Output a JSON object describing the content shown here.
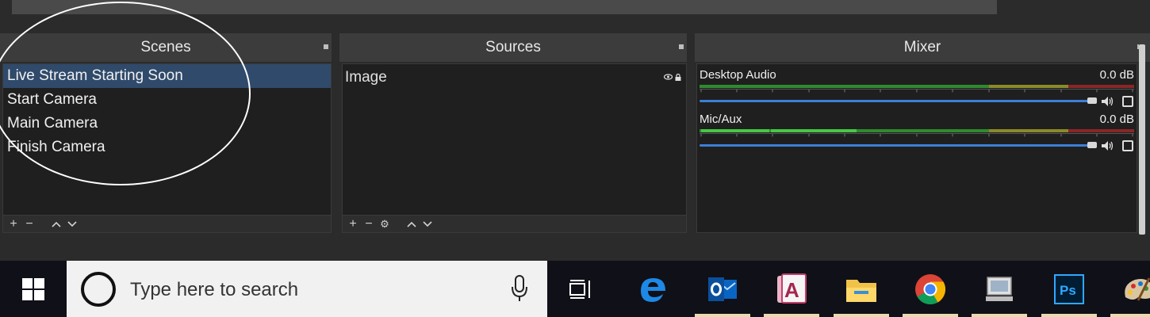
{
  "docks": {
    "scenes": {
      "title": "Scenes"
    },
    "sources": {
      "title": "Sources"
    },
    "mixer": {
      "title": "Mixer"
    }
  },
  "scenes": {
    "items": [
      {
        "label": "Live Stream Starting Soon",
        "selected": true
      },
      {
        "label": "Start Camera"
      },
      {
        "label": "Main Camera"
      },
      {
        "label": "Finish Camera"
      }
    ],
    "footer": {
      "add": "+",
      "remove": "−",
      "up": "⌃",
      "down": "⌄"
    }
  },
  "sources": {
    "items": [
      {
        "label": "Image",
        "visible": true,
        "locked": false
      }
    ],
    "footer": {
      "add": "+",
      "remove": "−",
      "settings": "⚙",
      "up": "⌃",
      "down": "⌄"
    }
  },
  "mixer": {
    "channels": [
      {
        "name": "Desktop Audio",
        "level": "0.0 dB",
        "volume": 1.0
      },
      {
        "name": "Mic/Aux",
        "level": "0.0 dB",
        "volume": 1.0
      }
    ]
  },
  "taskbar": {
    "search_placeholder": "Type here to search",
    "icons": [
      "windows-start",
      "task-view",
      "edge",
      "outlook",
      "access",
      "file-explorer",
      "chrome",
      "network-device",
      "photoshop",
      "paint"
    ]
  },
  "colors": {
    "selection": "#2f4a6a",
    "slider": "#3d7fd6",
    "meter_green": "#2e8b2e",
    "meter_yellow": "#8a8a2a",
    "meter_red": "#8b2626"
  }
}
